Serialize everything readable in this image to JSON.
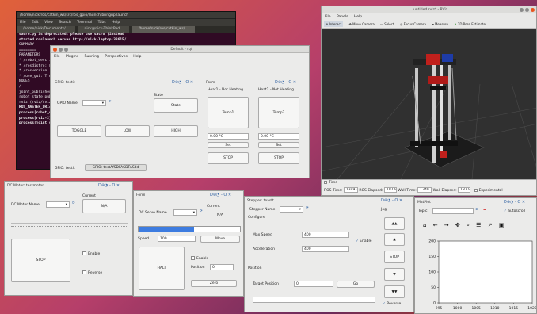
{
  "terminal": {
    "title": "/home/nick/ros/catkin_ws/src/ros_gpio/launch/bringup.launch",
    "menu": [
      "File",
      "Edit",
      "View",
      "Search",
      "Terminal",
      "Tabs",
      "Help"
    ],
    "tabs": [
      "/home/nick/Documents/...",
      "nick@nick-ThinkPad...",
      "/home/nick/ros/catkin_ws/..."
    ],
    "lines": [
      "sacro.py is deprecated; please use sacro (instead",
      "started roslaunch server http://nick-laptop:38615/",
      "",
      "SUMMARY",
      "========",
      "",
      "PARAMETERS",
      " * /robot_description",
      " * /rosdistro: melodic",
      " * /rosversion: 1.14.3",
      " * /use_gui: True",
      "",
      "NODES",
      "  /",
      "    joint_publisher (joint_state...)",
      "    robot_state_publisher (robot_...)",
      "    rviz (rviz/rviz)",
      "",
      "ROS_MASTER_URI=http://localhost:11311",
      "",
      "process[robot_state_publisher-1]: started",
      "process[rviz-2]: started",
      "process[joint_state_publisher-3]: started"
    ]
  },
  "rqt": {
    "title": "Default - rqt",
    "menu": [
      "File",
      "Plugins",
      "Running",
      "Perspectives",
      "Help"
    ],
    "gpio": {
      "title": "GPIO: testit",
      "name_label": "GPIO Name",
      "state_label": "State",
      "state_btn": "State",
      "toggle": "TOGGLE",
      "low": "LOW",
      "high": "HIGH",
      "footer_left": "GPIO: testit",
      "footer_tab": "GPIO: testAfSDFASDFASdd",
      "ctl": "D⊕◔ - O ✕"
    },
    "form": {
      "title": "Form",
      "heat1": "Heat1 - Not Heating",
      "heat2": "Heat2 - Not Heating",
      "temp1": "Temp1",
      "temp2": "Temp2",
      "val1": "0.00 °C",
      "val2": "0.00 °C",
      "set": "Set",
      "stop": "STOP",
      "ctl": "D⊕◔ - O ✕"
    }
  },
  "rviz": {
    "title": "untitled.rviz* - RViz",
    "menu": [
      "File",
      "Panels",
      "Help"
    ],
    "tools": [
      "Interact",
      "Move Camera",
      "Select",
      "Focus Camera",
      "Measure",
      "2D Pose Estimate"
    ],
    "time": {
      "title": "Time",
      "ros_time_label": "ROS Time:",
      "ros_time": "1349.34",
      "ros_elapsed_label": "ROS Elapsed:",
      "ros_elapsed": "187.97",
      "wall_time_label": "Wall Time:",
      "wall_time": "1349.37",
      "wall_elapsed_label": "Wall Elapsed:",
      "wall_elapsed": "187.90",
      "experimental": "Experimental"
    }
  },
  "dcmotor": {
    "title": "DC Motor: testmotor",
    "current_label": "Current",
    "name_label": "DC Motor Name",
    "current_val": "N/A",
    "stop": "STOP",
    "enable": "Enable",
    "reverse": "Reverse",
    "ctl": "D⊕◔ - O ✕"
  },
  "servo": {
    "title": "Form",
    "current_label": "Current",
    "name_label": "DC Servo Name",
    "current_val": "N/A",
    "speed_label": "Speed",
    "speed_val": "100",
    "move": "Move",
    "halt": "HALT",
    "enable": "Enable",
    "position_label": "Position",
    "position_val": "0",
    "zero": "Zero",
    "ctl": "D⊕◔ - O ✕"
  },
  "stepper": {
    "title": "Stepper: teastt",
    "name_label": "Stepper Name",
    "configure": "Configure",
    "jog": "Jog",
    "max_speed_label": "Max Speed",
    "max_speed": "400",
    "accel_label": "Acceleration",
    "accel": "400",
    "enable": "Enable",
    "position": "Position",
    "target_label": "Target Position",
    "target": "0",
    "go": "Go",
    "stop": "STOP",
    "reverse": "Reverse",
    "up2": "▲▲",
    "up": "▲",
    "down": "▼",
    "down2": "▼▼",
    "ctl": "D⊕◔ - O ✕"
  },
  "plot": {
    "title": "MatPlot",
    "topic_label": "Topic:",
    "autoscroll": "autoscroll",
    "ctl": "D⊕◔ - O ✕"
  },
  "chart_data": {
    "type": "line",
    "x_ticks": [
      "995",
      "1000",
      "1005",
      "1010",
      "1015",
      "1020"
    ],
    "y_ticks": [
      "200",
      "150",
      "100",
      "50",
      "0"
    ],
    "ylim": [
      0,
      200
    ],
    "xlim": [
      995,
      1020
    ],
    "series": []
  }
}
